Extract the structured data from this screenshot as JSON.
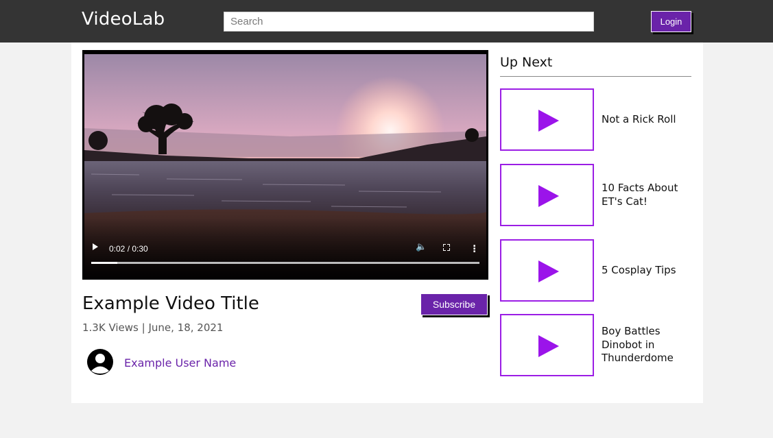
{
  "header": {
    "brand": "VideoLab",
    "search_placeholder": "Search",
    "login_label": "Login"
  },
  "player": {
    "time_display": "0:02 / 0:30",
    "progress_fraction": 0.0667,
    "icons": [
      "play-icon",
      "volume-icon",
      "fullscreen-icon",
      "more-options-icon"
    ]
  },
  "video": {
    "title": "Example Video Title",
    "meta": "1.3K Views | June, 18, 2021",
    "subscribe_label": "Subscribe",
    "user_name": "Example User Name"
  },
  "up_next": {
    "heading": "Up Next",
    "items": [
      {
        "label": "Not a Rick Roll"
      },
      {
        "label": "10 Facts About ET's Cat!"
      },
      {
        "label": "5 Cosplay Tips"
      },
      {
        "label": "Boy Battles Dinobot in Thunderdome"
      }
    ]
  },
  "colors": {
    "accent": "#6a23a9",
    "thumb_border": "#9b1de5",
    "topbar": "#343434"
  }
}
